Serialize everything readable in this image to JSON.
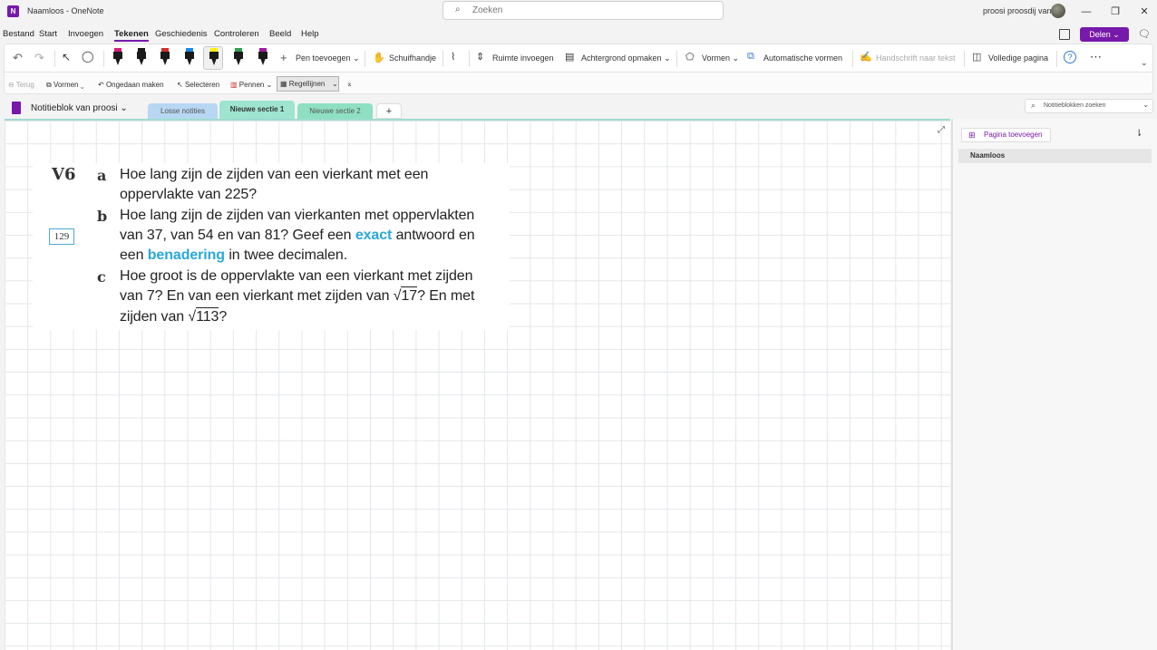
{
  "window": {
    "title": "Naamloos - OneNote",
    "search_placeholder": "Zoeken",
    "user": "proosi proosdij van",
    "controls": [
      "—",
      "❐",
      "✕"
    ]
  },
  "menu": {
    "items": [
      "Bestand",
      "Start",
      "Invoegen",
      "Tekenen",
      "Geschiedenis",
      "Controleren",
      "Beeld",
      "Help"
    ],
    "active": "Tekenen",
    "share_label": "Delen"
  },
  "ribbon": {
    "pen_toevoegen": "Pen toevoegen",
    "schuifhandje": "Schuifhandje",
    "ruimte_invoegen": "Ruimte invoegen",
    "achtergrond": "Achtergrond opmaken",
    "vormen": "Vormen",
    "automatische_vormen": "Automatische vormen",
    "handschrift": "Handschrift naar tekst",
    "volledige_pagina": "Volledige pagina",
    "pens": [
      {
        "band": "#d81b7c",
        "tip": "#1a1a1a"
      },
      {
        "band": "#1a1a1a",
        "tip": "#1a1a1a"
      },
      {
        "band": "#d32f2f",
        "tip": "#1a1a1a"
      },
      {
        "band": "#1e88e5",
        "tip": "#1a1a1a"
      },
      {
        "band": "#ffee00",
        "tip": "#1a1a1a"
      },
      {
        "band": "#2e9e4f",
        "tip": "#1a1a1a"
      },
      {
        "band": "#a01aa0",
        "tip": "#1a1a1a"
      }
    ]
  },
  "ribbon2": {
    "terug": "Terug",
    "vormen": "Vormen",
    "ongedaan": "Ongedaan maken",
    "selecteren": "Selecteren",
    "pennen": "Pennen",
    "regellijnen": "Regellijnen"
  },
  "notebook": {
    "name": "Notitieblok van proosi",
    "tabs": [
      {
        "label": "Losse notities",
        "color": "#b7d7f2"
      },
      {
        "label": "Nieuwe sectie 1",
        "color": "#9ee4cf"
      },
      {
        "label": "Nieuwe sectie 2",
        "color": "#8fe0c3"
      }
    ],
    "add_tab": "+",
    "search_placeholder": "Notitieblokken zoeken"
  },
  "exercise": {
    "number": "V6",
    "page_ref": "129",
    "a_label": "a",
    "a_lines": [
      "Hoe lang zijn de zijden van een vierkant met een",
      "oppervlakte van 225?"
    ],
    "b_label": "b",
    "b_line1": "Hoe lang zijn de zijden van vierkanten met oppervlakten",
    "b_line2_pre": "van 37, van 54 en van 81? Geef een ",
    "b_line2_hl": "exact",
    "b_line2_post": " antwoord en",
    "b_line3_pre": "een ",
    "b_line3_hl": "benadering",
    "b_line3_post": " in twee decimalen.",
    "c_label": "c",
    "c_line1": "Hoe groot is de oppervlakte van een vierkant met zijden",
    "c_line2_pre": "van 7? En van een vierkant met zijden van ",
    "c_line2_root": "17",
    "c_line2_post": "? En met",
    "c_line3_pre": "zijden van ",
    "c_line3_root": "113",
    "c_line3_post": "?"
  },
  "pages": {
    "add_label": "Pagina toevoegen",
    "items": [
      "Naamloos"
    ]
  }
}
